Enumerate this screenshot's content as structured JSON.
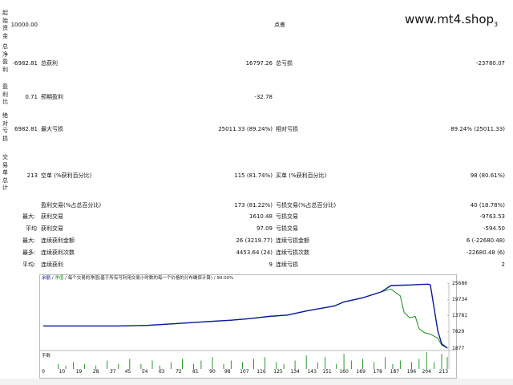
{
  "watermark": "www.mt4.shop",
  "watermark_sub": "3",
  "vertical_labels": [
    {
      "id": "deposit",
      "text": "起始资金"
    },
    {
      "id": "netprofit",
      "text": "总净盈利"
    },
    {
      "id": "profitfactor",
      "text": "盈利比"
    },
    {
      "id": "drawdown",
      "text": "绝对亏损"
    },
    {
      "id": "trades",
      "text": "交易单总计"
    }
  ],
  "rows": {
    "deposit": {
      "value": "10000.00",
      "label": "点差"
    },
    "net": {
      "value": "-6982.81",
      "l1": "总获利",
      "v1": "16797.26",
      "l2": "总亏损",
      "v2": "-23780.07"
    },
    "pf": {
      "value": "0.71",
      "l1": "预期盈利",
      "v1": "-32.78"
    },
    "dd": {
      "value": "6982.81",
      "l1": "最大亏损",
      "v1": "25011.33 (89.24%)",
      "l2": "相对亏损",
      "v2": "89.24% (25011.33)"
    },
    "trades": {
      "value": "213",
      "l1": "空单 (%获利百分比)",
      "v1": "115 (81.74%)",
      "l2": "买单 (%获利百分比)",
      "v2": "98 (80.61%)"
    }
  },
  "stats": [
    {
      "prefix": "",
      "l1": "盈利交易(%占总百分比)",
      "v1": "173 (81.22%)",
      "l2": "亏损交易(%占总百分比)",
      "v2": "40 (18.78%)"
    },
    {
      "prefix": "最大:",
      "l1": "获利交易",
      "v1": "1610.48",
      "l2": "亏损交易",
      "v2": "-9763.53"
    },
    {
      "prefix": "平均",
      "l1": "获利交易",
      "v1": "97.09",
      "l2": "亏损交易",
      "v2": "-594.50"
    },
    {
      "prefix": "最大:",
      "l1": "连续获利金额",
      "v1": "26 (3219.77)",
      "l2": "连续亏损金额",
      "v2": "6 (-22680.48)"
    },
    {
      "prefix": "最多:",
      "l1": "连续获利次数",
      "v1": "4453.64 (24)",
      "l2": "连续亏损次数",
      "v2": "-22680.48 (6)"
    },
    {
      "prefix": "平均:",
      "l1": "连续获利",
      "v1": "9",
      "l2": "连续亏损",
      "v2": "2"
    }
  ],
  "chart_title": {
    "part1": "余额",
    "sep": " / ",
    "part2": "净值",
    "rest": " / 每个交易的净值(基于所有可利用交易小时数的每一个价格的分布确保计算) / 90.00%"
  },
  "volume_label": "手数",
  "chart_data": {
    "type": "line",
    "series": [
      {
        "name": "余额",
        "color": "#0a1a9c",
        "x": [
          0,
          25,
          40,
          55,
          70,
          85,
          100,
          110,
          120,
          130,
          140,
          145,
          155,
          160,
          170,
          180,
          185,
          195,
          200,
          205,
          206,
          210,
          212,
          215
        ],
        "y": [
          10000,
          10000,
          10000,
          10200,
          10800,
          11500,
          12100,
          12700,
          13500,
          14000,
          15500,
          16100,
          17300,
          18800,
          20300,
          22500,
          24800,
          25000,
          25200,
          25300,
          25000,
          8000,
          3500,
          1900
        ]
      },
      {
        "name": "净值",
        "color": "#1a8a1a",
        "x": [
          0,
          25,
          40,
          55,
          70,
          85,
          100,
          110,
          120,
          130,
          140,
          145,
          155,
          160,
          170,
          180,
          185,
          190,
          192,
          195,
          198,
          200,
          203,
          206,
          210,
          212,
          215
        ],
        "y": [
          10000,
          10000,
          10000,
          10200,
          10800,
          11500,
          12100,
          12700,
          13500,
          14000,
          15500,
          16100,
          17300,
          18800,
          20300,
          22500,
          23500,
          21000,
          15000,
          13000,
          13500,
          9000,
          7500,
          7000,
          5500,
          3000,
          1900
        ]
      }
    ],
    "volume": [
      [
        8,
        3
      ],
      [
        12,
        2
      ],
      [
        16,
        4
      ],
      [
        22,
        3
      ],
      [
        28,
        2
      ],
      [
        34,
        5
      ],
      [
        40,
        3
      ],
      [
        46,
        6
      ],
      [
        52,
        3
      ],
      [
        58,
        5
      ],
      [
        62,
        2
      ],
      [
        68,
        4
      ],
      [
        74,
        6
      ],
      [
        80,
        3
      ],
      [
        84,
        5
      ],
      [
        90,
        7
      ],
      [
        96,
        3
      ],
      [
        100,
        5
      ],
      [
        106,
        4
      ],
      [
        112,
        6
      ],
      [
        118,
        7
      ],
      [
        124,
        4
      ],
      [
        128,
        3
      ],
      [
        134,
        5
      ],
      [
        140,
        8
      ],
      [
        146,
        4
      ],
      [
        150,
        7
      ],
      [
        156,
        3
      ],
      [
        160,
        9
      ],
      [
        164,
        5
      ],
      [
        170,
        6
      ],
      [
        176,
        4
      ],
      [
        182,
        7
      ],
      [
        186,
        3
      ],
      [
        190,
        5
      ],
      [
        196,
        4
      ],
      [
        200,
        6
      ],
      [
        204,
        10
      ],
      [
        208,
        4
      ],
      [
        212,
        9
      ],
      [
        215,
        7
      ]
    ],
    "yticks": [
      25686,
      19734,
      13781,
      7829,
      1877
    ],
    "xticks": [
      0,
      10,
      19,
      28,
      37,
      45,
      54,
      63,
      72,
      81,
      90,
      98,
      107,
      116,
      125,
      134,
      143,
      151,
      160,
      169,
      178,
      187,
      196,
      204,
      213
    ],
    "ylim": [
      1877,
      25686
    ],
    "xlim": [
      0,
      215
    ]
  }
}
